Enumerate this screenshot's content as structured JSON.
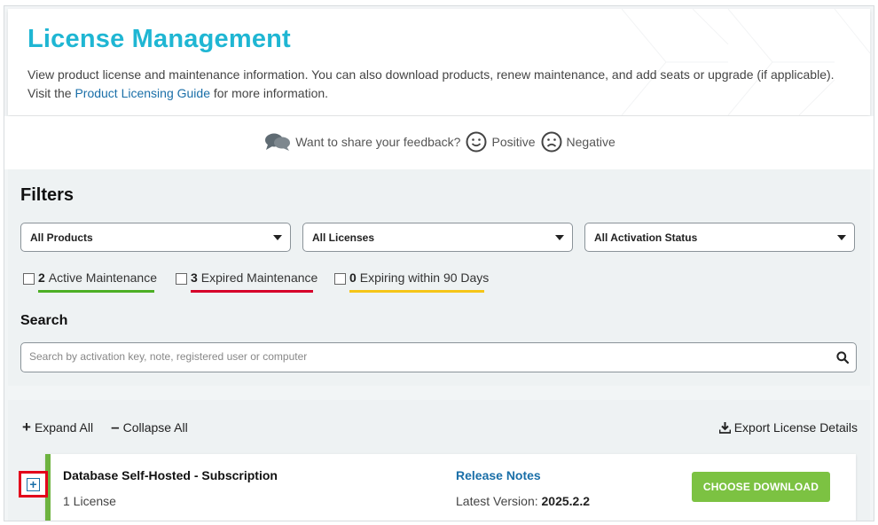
{
  "header": {
    "title": "License Management",
    "description_before": "View product license and maintenance information. You can also download products, renew maintenance, and add seats or upgrade (if applicable). Visit the ",
    "guide_link": "Product Licensing Guide",
    "description_after": " for more information."
  },
  "feedback": {
    "prompt": "Want to share your feedback?",
    "positive": "Positive",
    "negative": "Negative"
  },
  "filters": {
    "title": "Filters",
    "selects": {
      "products": "All Products",
      "licenses": "All Licenses",
      "activation": "All Activation Status"
    },
    "checkboxes": {
      "active": {
        "count": "2",
        "label": "Active Maintenance",
        "color": "#4caf24"
      },
      "expired": {
        "count": "3",
        "label": "Expired Maintenance",
        "color": "#d6002a"
      },
      "expiring": {
        "count": "0",
        "label": "Expiring within 90 Days",
        "color": "#f5c518"
      }
    }
  },
  "search": {
    "title": "Search",
    "placeholder": "Search by activation key, note, registered user or computer"
  },
  "toolbar": {
    "expand_all": "Expand All",
    "collapse_all": "Collapse All",
    "export": "Export License Details"
  },
  "licenses": [
    {
      "product": "Database Self-Hosted - Subscription",
      "count": "1 License",
      "release_notes": "Release Notes",
      "latest_label": "Latest Version:",
      "latest_version": "2025.2.2",
      "download_button": "CHOOSE DOWNLOAD"
    }
  ],
  "colors": {
    "title": "#1fb6d3",
    "link": "#1a6fa8",
    "download_button": "#7cc242",
    "highlight": "#e3001b"
  },
  "icons": {
    "feedback": "chat-bubbles-icon",
    "positive": "smile-icon",
    "negative": "frown-icon",
    "search": "search-icon",
    "export": "download-icon",
    "expand": "plus-square-icon"
  }
}
